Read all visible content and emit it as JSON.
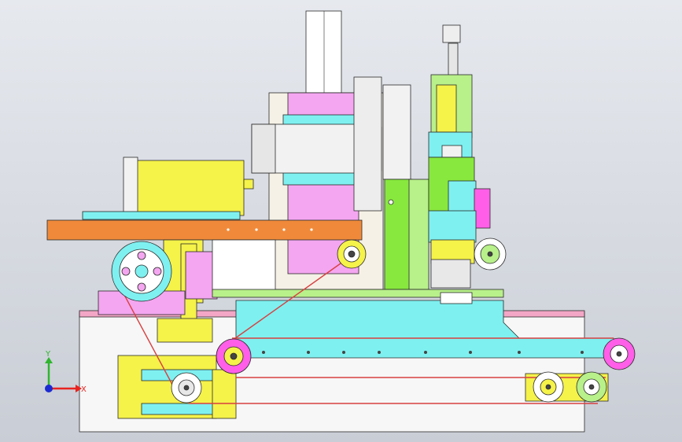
{
  "viewport": {
    "background_top": "#e6e9ee",
    "background_bottom": "#c9cdd5"
  },
  "triad": {
    "x_label": "X",
    "y_label": "Y",
    "x_color": "#e8231f",
    "y_color": "#2fb52f",
    "z_color": "#1b2bd1"
  },
  "palette": {
    "pink": "#f4a6f0",
    "cyan": "#7ff0f0",
    "yellow": "#f5f24a",
    "orange": "#f08a3a",
    "green": "#88e83e",
    "lightgreen": "#b8f08a",
    "magenta": "#ff5fe8",
    "white": "#ffffff",
    "lightgray": "#e8e8e8",
    "belt": "#d84040",
    "outline": "#2a2a2a"
  }
}
